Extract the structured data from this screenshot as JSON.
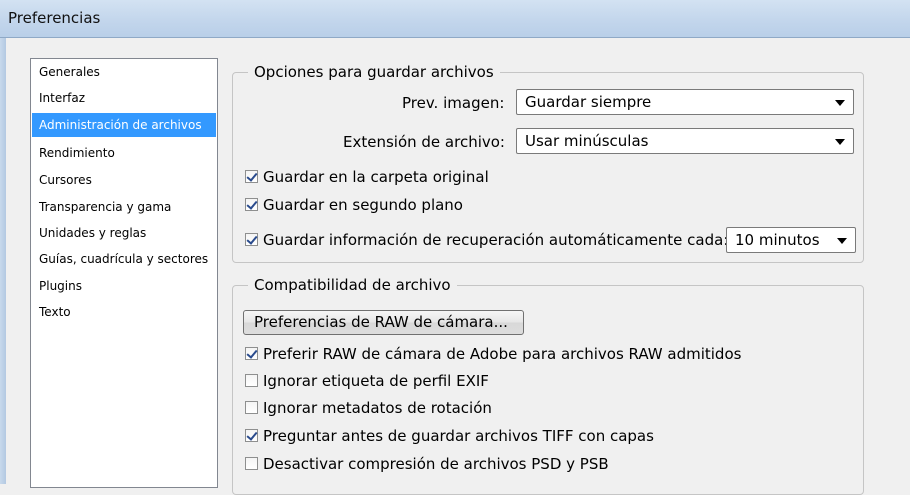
{
  "window": {
    "title": "Preferencias"
  },
  "sidebar": {
    "items": [
      {
        "label": "Generales",
        "selected": false
      },
      {
        "label": "Interfaz",
        "selected": false
      },
      {
        "label": "Administración de archivos",
        "selected": true
      },
      {
        "label": "Rendimiento",
        "selected": false
      },
      {
        "label": "Cursores",
        "selected": false
      },
      {
        "label": "Transparencia y gama",
        "selected": false
      },
      {
        "label": "Unidades y reglas",
        "selected": false
      },
      {
        "label": "Guías, cuadrícula y sectores",
        "selected": false
      },
      {
        "label": "Plugins",
        "selected": false
      },
      {
        "label": "Texto",
        "selected": false
      }
    ]
  },
  "save_options": {
    "legend": "Opciones para guardar archivos",
    "preview_label": "Prev. imagen:",
    "preview_value": "Guardar siempre",
    "extension_label": "Extensión de archivo:",
    "extension_value": "Usar minúsculas",
    "checkboxes": [
      {
        "label": "Guardar en la carpeta original",
        "checked": true
      },
      {
        "label": "Guardar en segundo plano",
        "checked": true
      },
      {
        "label": "Guardar información de recuperación automáticamente cada:",
        "checked": true
      }
    ],
    "recovery_interval": "10 minutos"
  },
  "compat": {
    "legend": "Compatibilidad de archivo",
    "raw_button": "Preferencias de RAW de cámara...",
    "checkboxes": [
      {
        "label": "Preferir RAW de cámara de Adobe para archivos RAW admitidos",
        "checked": true
      },
      {
        "label": "Ignorar etiqueta de perfil EXIF",
        "checked": false
      },
      {
        "label": "Ignorar metadatos de rotación",
        "checked": false
      },
      {
        "label": "Preguntar antes de guardar archivos TIFF con capas",
        "checked": true
      },
      {
        "label": "Desactivar compresión de archivos PSD y PSB",
        "checked": false
      }
    ]
  },
  "colors": {
    "selection": "#3399ff",
    "titlebar": "#c3d6ec"
  }
}
